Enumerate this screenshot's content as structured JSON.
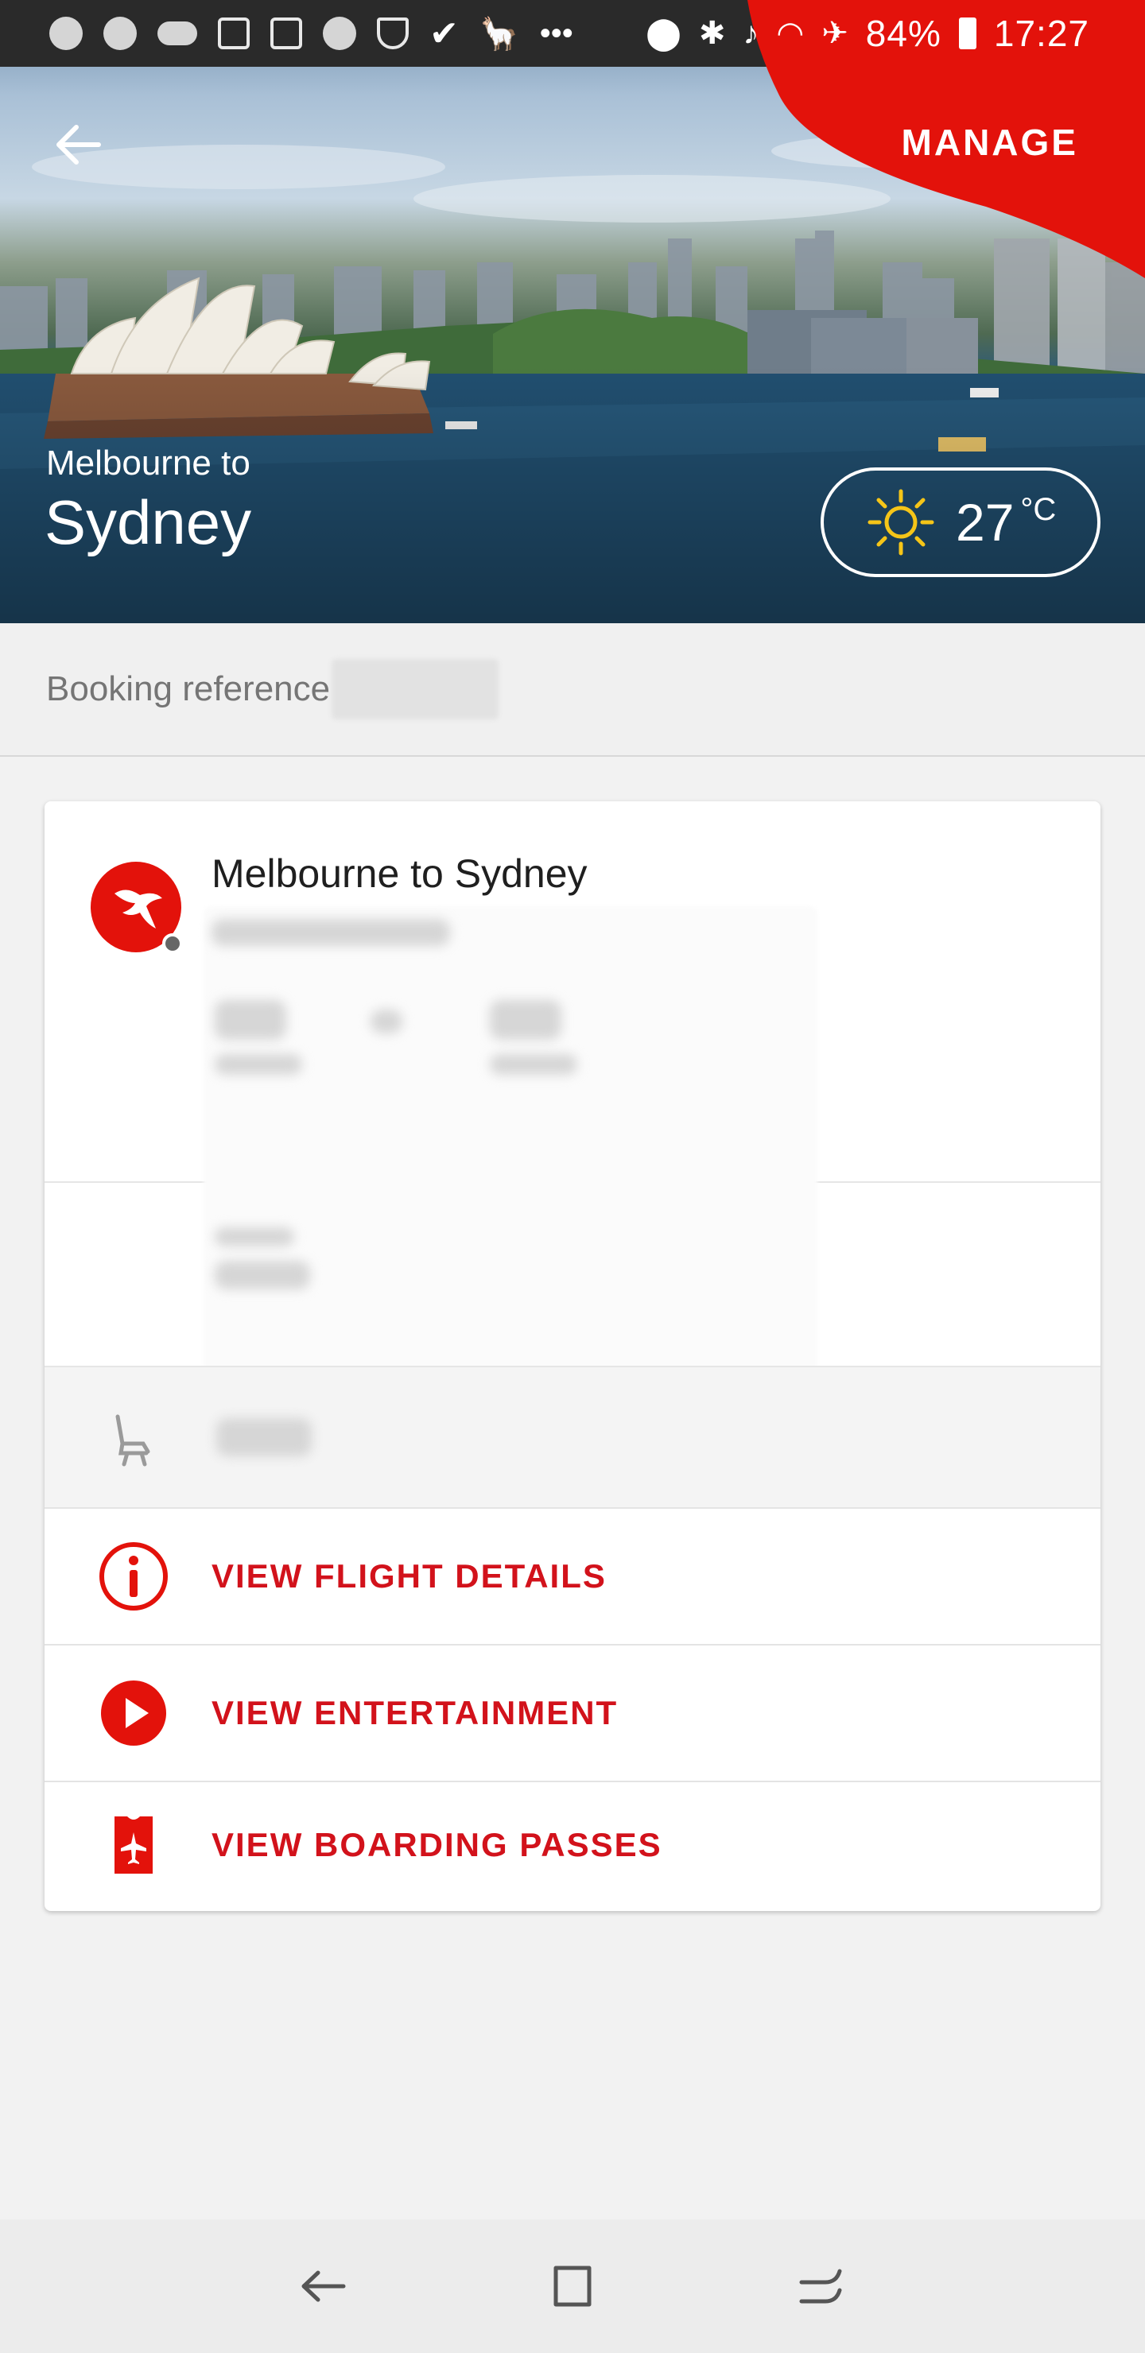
{
  "status_bar": {
    "battery": "84%",
    "time": "17:27"
  },
  "header": {
    "manage_label": "MANAGE",
    "from_label": "Melbourne to",
    "destination": "Sydney",
    "weather": {
      "temperature": "27",
      "unit": "°C",
      "icon": "sun-icon"
    }
  },
  "booking": {
    "label": "Booking reference"
  },
  "flight_card": {
    "title": "Melbourne to Sydney",
    "airline_logo": "qantas-kangaroo-logo",
    "actions": [
      {
        "label": "VIEW FLIGHT DETAILS",
        "icon": "info-icon"
      },
      {
        "label": "VIEW ENTERTAINMENT",
        "icon": "play-icon"
      },
      {
        "label": "VIEW BOARDING PASSES",
        "icon": "boarding-pass-icon"
      }
    ]
  },
  "colors": {
    "brand_red": "#e3120b",
    "action_red": "#d2121b"
  }
}
